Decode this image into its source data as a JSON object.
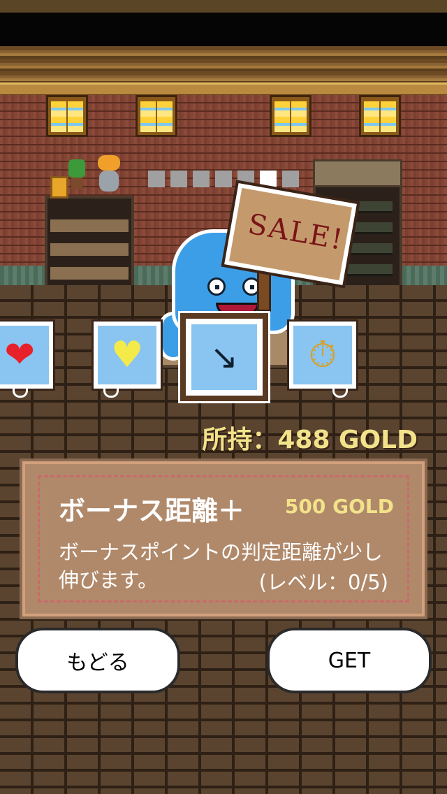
{
  "shop": {
    "page_dots": {
      "count": 7,
      "active_index": 5
    },
    "sign_text": "SALE!",
    "owned_gold_label": "所持：488 GOLD",
    "items": [
      {
        "name": "hearts-item",
        "icon": "hearts-icon",
        "glyph": "❤"
      },
      {
        "name": "gold-heart-item",
        "icon": "gold-heart-icon",
        "glyph": "💛"
      },
      {
        "name": "bonus-distance-item",
        "icon": "bonus-distance-icon",
        "glyph": "↘"
      },
      {
        "name": "stopwatch-item",
        "icon": "stopwatch-icon",
        "glyph": "⏱"
      }
    ],
    "selected": {
      "name": "ボーナス距離＋",
      "price": "500 GOLD",
      "description": "ボーナスポイントの判定距離が少し伸びます。",
      "level": "(レベル：0/5)"
    },
    "buttons": {
      "back_label": "もどる",
      "get_label": "GET"
    }
  },
  "colors": {
    "gold_text": "#f2e28a",
    "panel_bg": "#b0896a",
    "monster_blue": "#3d9ee8"
  }
}
